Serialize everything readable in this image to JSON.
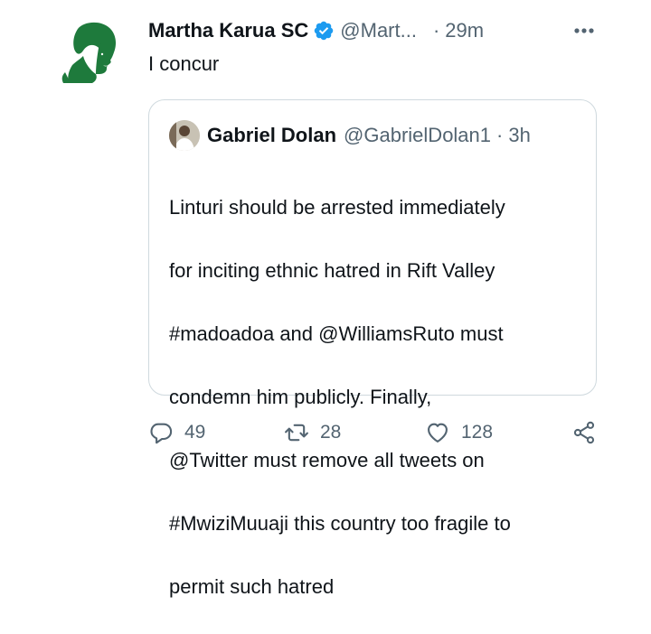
{
  "tweet": {
    "author_name": "Martha Karua SC",
    "author_handle": "@Mart...",
    "separator": "·",
    "time": "29m",
    "verified": true,
    "text": "I concur"
  },
  "quoted_tweet": {
    "author_name": "Gabriel Dolan",
    "author_handle": "@GabrielDolan1",
    "separator": "·",
    "time": "3h",
    "lines": [
      "Linturi should be arrested immediately",
      "for inciting ethnic hatred in Rift Valley",
      "#madoadoa and @WilliamsRuto must",
      "condemn him publicly.  Finally,",
      "@Twitter must remove all tweets on",
      "#MwiziMuuaji this country too fragile to",
      "permit such hatred"
    ]
  },
  "actions": {
    "replies": "49",
    "retweets": "28",
    "likes": "128",
    "reply_icon": "reply-icon",
    "retweet_icon": "retweet-icon",
    "like_icon": "heart-icon",
    "share_icon": "share-icon"
  },
  "colors": {
    "text": "#0f1419",
    "secondary": "#536471",
    "verified": "#1d9bf0",
    "border": "#cfd9de",
    "avatar_green": "#1e7a3c"
  }
}
